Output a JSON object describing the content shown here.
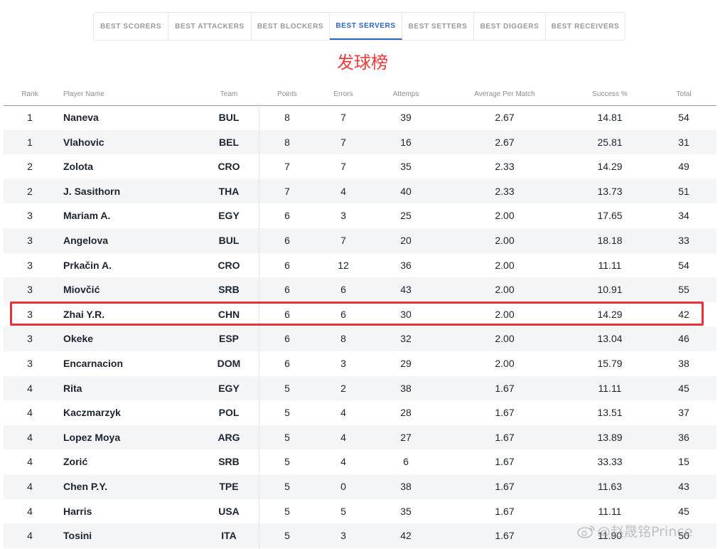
{
  "tabs": [
    {
      "label": "BEST SCORERS",
      "active": false
    },
    {
      "label": "BEST ATTACKERS",
      "active": false
    },
    {
      "label": "BEST BLOCKERS",
      "active": false
    },
    {
      "label": "BEST SERVERS",
      "active": true
    },
    {
      "label": "BEST SETTERS",
      "active": false
    },
    {
      "label": "BEST DIGGERS",
      "active": false
    },
    {
      "label": "BEST RECEIVERS",
      "active": false
    }
  ],
  "heading": "发球榜",
  "columns": {
    "rank": "Rank",
    "player": "Player Name",
    "team": "Team",
    "points": "Points",
    "errors": "Errors",
    "attempts": "Attemps",
    "avg": "Average Per Match",
    "success": "Success %",
    "total": "Total"
  },
  "rows": [
    {
      "rank": "1",
      "player": "Naneva",
      "team": "BUL",
      "points": "8",
      "errors": "7",
      "attempts": "39",
      "avg": "2.67",
      "success": "14.81",
      "total": "54"
    },
    {
      "rank": "1",
      "player": "Vlahovic",
      "team": "BEL",
      "points": "8",
      "errors": "7",
      "attempts": "16",
      "avg": "2.67",
      "success": "25.81",
      "total": "31"
    },
    {
      "rank": "2",
      "player": "Zolota",
      "team": "CRO",
      "points": "7",
      "errors": "7",
      "attempts": "35",
      "avg": "2.33",
      "success": "14.29",
      "total": "49"
    },
    {
      "rank": "2",
      "player": "J. Sasithorn",
      "team": "THA",
      "points": "7",
      "errors": "4",
      "attempts": "40",
      "avg": "2.33",
      "success": "13.73",
      "total": "51"
    },
    {
      "rank": "3",
      "player": "Mariam A.",
      "team": "EGY",
      "points": "6",
      "errors": "3",
      "attempts": "25",
      "avg": "2.00",
      "success": "17.65",
      "total": "34"
    },
    {
      "rank": "3",
      "player": "Angelova",
      "team": "BUL",
      "points": "6",
      "errors": "7",
      "attempts": "20",
      "avg": "2.00",
      "success": "18.18",
      "total": "33"
    },
    {
      "rank": "3",
      "player": "Prkačin A.",
      "team": "CRO",
      "points": "6",
      "errors": "12",
      "attempts": "36",
      "avg": "2.00",
      "success": "11.11",
      "total": "54"
    },
    {
      "rank": "3",
      "player": "Miovčić",
      "team": "SRB",
      "points": "6",
      "errors": "6",
      "attempts": "43",
      "avg": "2.00",
      "success": "10.91",
      "total": "55"
    },
    {
      "rank": "3",
      "player": "Zhai Y.R.",
      "team": "CHN",
      "points": "6",
      "errors": "6",
      "attempts": "30",
      "avg": "2.00",
      "success": "14.29",
      "total": "42",
      "highlighted": true
    },
    {
      "rank": "3",
      "player": "Okeke",
      "team": "ESP",
      "points": "6",
      "errors": "8",
      "attempts": "32",
      "avg": "2.00",
      "success": "13.04",
      "total": "46"
    },
    {
      "rank": "3",
      "player": "Encarnacion",
      "team": "DOM",
      "points": "6",
      "errors": "3",
      "attempts": "29",
      "avg": "2.00",
      "success": "15.79",
      "total": "38"
    },
    {
      "rank": "4",
      "player": "Rita",
      "team": "EGY",
      "points": "5",
      "errors": "2",
      "attempts": "38",
      "avg": "1.67",
      "success": "11.11",
      "total": "45"
    },
    {
      "rank": "4",
      "player": "Kaczmarzyk",
      "team": "POL",
      "points": "5",
      "errors": "4",
      "attempts": "28",
      "avg": "1.67",
      "success": "13.51",
      "total": "37"
    },
    {
      "rank": "4",
      "player": "Lopez Moya",
      "team": "ARG",
      "points": "5",
      "errors": "4",
      "attempts": "27",
      "avg": "1.67",
      "success": "13.89",
      "total": "36"
    },
    {
      "rank": "4",
      "player": "Zorić",
      "team": "SRB",
      "points": "5",
      "errors": "4",
      "attempts": "6",
      "avg": "1.67",
      "success": "33.33",
      "total": "15"
    },
    {
      "rank": "4",
      "player": "Chen P.Y.",
      "team": "TPE",
      "points": "5",
      "errors": "0",
      "attempts": "38",
      "avg": "1.67",
      "success": "11.63",
      "total": "43"
    },
    {
      "rank": "4",
      "player": "Harris",
      "team": "USA",
      "points": "5",
      "errors": "5",
      "attempts": "35",
      "avg": "1.67",
      "success": "11.11",
      "total": "45"
    },
    {
      "rank": "4",
      "player": "Tosini",
      "team": "ITA",
      "points": "5",
      "errors": "3",
      "attempts": "42",
      "avg": "1.67",
      "success": "11.90",
      "total": "50"
    }
  ],
  "watermark": "@赵晟铭Prince",
  "colors": {
    "accent": "#2f63c2",
    "heading": "#ee3a3a",
    "highlight": "#e5333a"
  }
}
